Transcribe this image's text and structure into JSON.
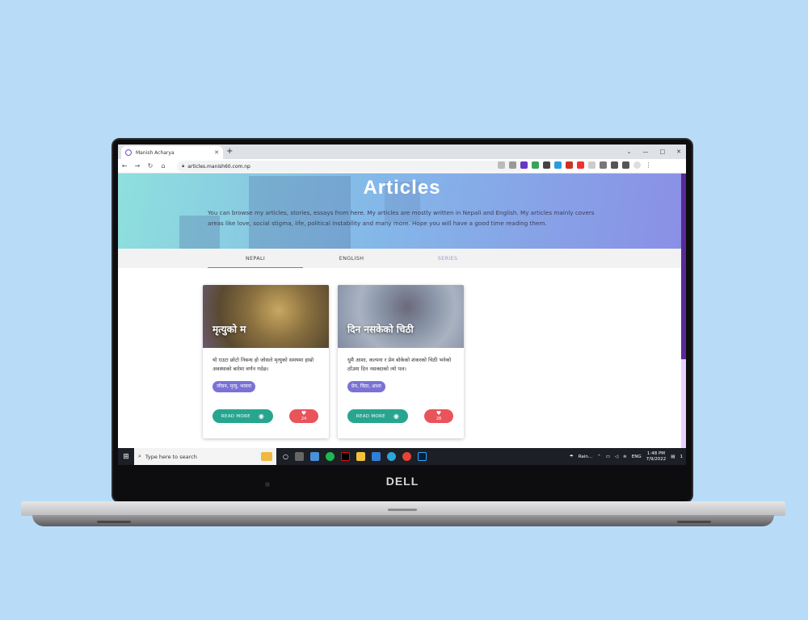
{
  "browser": {
    "tab_title": "Manish Acharya",
    "url": "articles.manish60.com.np",
    "new_tab": "+",
    "tab_close": "✕",
    "win_min": "—",
    "win_max": "□",
    "win_close": "✕",
    "win_chevron": "⌄"
  },
  "device": {
    "brand": "DELL"
  },
  "hero": {
    "title": "Articles",
    "description": "You can browse my articles, stories, essays from here. My articles are mostly written in Nepali and English. My articles mainly covers areas like love, social stigma, life, political instability and many more. Hope you will have a good time reading them."
  },
  "tabs": [
    {
      "label": "NEPALI"
    },
    {
      "label": "ENGLISH"
    },
    {
      "label": "SERIES"
    }
  ],
  "cards": [
    {
      "title": "मृत्युको म",
      "description": "यो एउटा छोटो निबन्ध हो जोसले मृत्युको समयमा हाम्रो अवस्थाको बारेमा वर्णन गर्दछ।",
      "tags": "जीवन, मृत्यु, भावना",
      "read_more": "READ MORE",
      "likes": "24"
    },
    {
      "title": "दिन नसकेको चिठी",
      "description": "धुमै आशा, कल्पना र प्रेम बोकेको शंकरको चिठी भनेको ठाँउमा दिन नसक्दाको त्यो पल।",
      "tags": "प्रेम, चिठा, आशा",
      "read_more": "READ MORE",
      "likes": "28"
    }
  ],
  "taskbar": {
    "search_placeholder": "Type here to search",
    "weather": "Rain...",
    "lang": "ENG",
    "time": "1:48 PM",
    "date": "7/9/2022",
    "notif_count": "1"
  },
  "colors": {
    "accent": "#7b72d6",
    "read_btn": "#27a58f",
    "like_btn": "#e8545a",
    "background": "#b8dcf8"
  }
}
